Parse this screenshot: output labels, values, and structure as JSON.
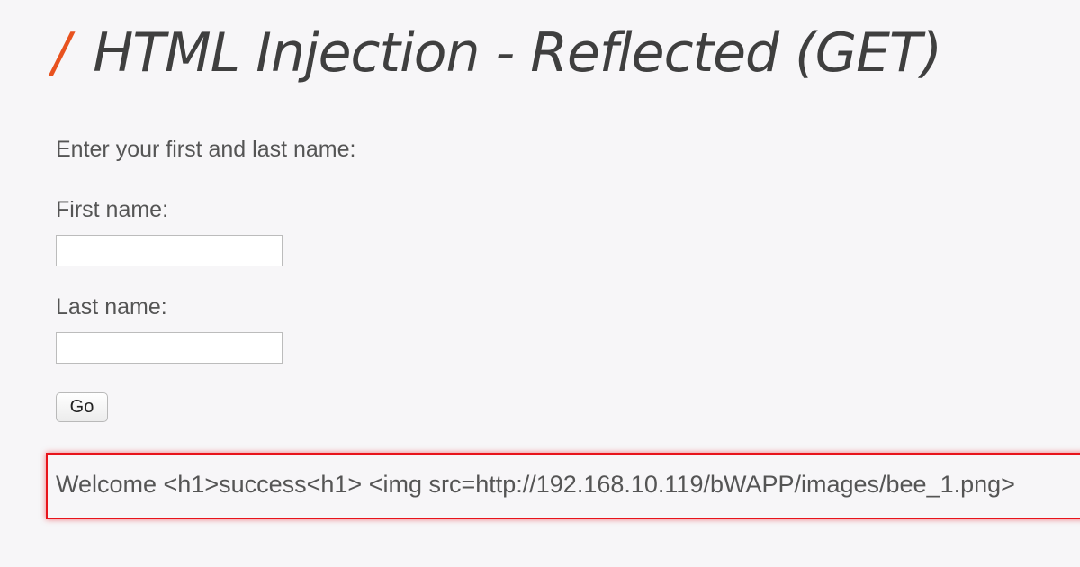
{
  "page": {
    "title_prefix": "/",
    "title": "HTML Injection - Reflected (GET)"
  },
  "form": {
    "intro": "Enter your first and last name:",
    "first_name_label": "First name:",
    "first_name_value": "",
    "last_name_label": "Last name:",
    "last_name_value": "",
    "go_label": "Go"
  },
  "result": {
    "text": "Welcome <h1>success<h1> <img src=http://192.168.10.119/bWAPP/images/bee_1.png>"
  },
  "colors": {
    "accent_slash": "#e8521f",
    "highlight_border": "#e8131b",
    "background": "#f7f6f8"
  }
}
